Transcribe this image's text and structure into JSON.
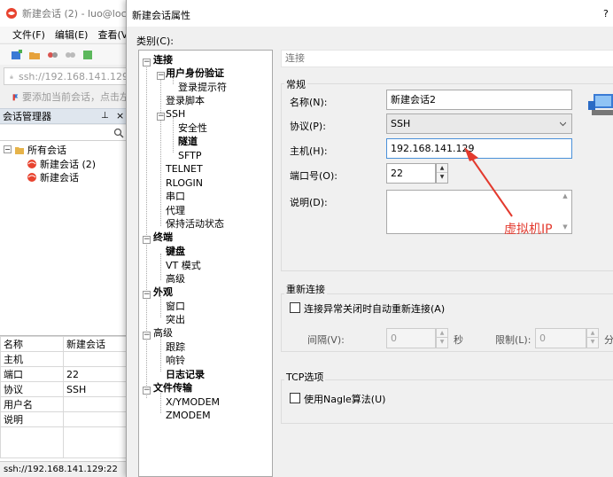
{
  "bg_app": {
    "title": "新建会话 (2) - luo@loca",
    "menu": [
      "文件(F)",
      "编辑(E)",
      "查看(V)"
    ],
    "address": "ssh://192.168.141.129",
    "hint": "要添加当前会话，点击左",
    "session_manager": {
      "title": "会话管理器",
      "pin": "ᵩ",
      "close": "×",
      "tree": {
        "root": "所有会话",
        "items": [
          "新建会话 (2)",
          "新建会话"
        ]
      }
    },
    "properties": [
      {
        "key": "名称",
        "value": "新建会话"
      },
      {
        "key": "主机",
        "value": ""
      },
      {
        "key": "端口",
        "value": "22"
      },
      {
        "key": "协议",
        "value": "SSH"
      },
      {
        "key": "用户名",
        "value": ""
      },
      {
        "key": "说明",
        "value": ""
      }
    ],
    "status": "ssh://192.168.141.129:22"
  },
  "dialog": {
    "title": "新建会话属性",
    "help": "?",
    "category_label": "类别(C):",
    "category_tree": [
      {
        "label": "连接",
        "bold": true
      },
      {
        "label": "用户身份验证",
        "bold": true
      },
      {
        "label": "登录提示符",
        "bold": false
      },
      {
        "label": "登录脚本",
        "bold": false
      },
      {
        "label": "SSH",
        "bold": false
      },
      {
        "label": "安全性",
        "bold": false
      },
      {
        "label": "隧道",
        "bold": true
      },
      {
        "label": "SFTP",
        "bold": false
      },
      {
        "label": "TELNET",
        "bold": false
      },
      {
        "label": "RLOGIN",
        "bold": false
      },
      {
        "label": "串口",
        "bold": false
      },
      {
        "label": "代理",
        "bold": false
      },
      {
        "label": "保持活动状态",
        "bold": false
      },
      {
        "label": "终端",
        "bold": true
      },
      {
        "label": "键盘",
        "bold": true
      },
      {
        "label": "VT 模式",
        "bold": false
      },
      {
        "label": "高级",
        "bold": false
      },
      {
        "label": "外观",
        "bold": true
      },
      {
        "label": "窗口",
        "bold": false
      },
      {
        "label": "突出",
        "bold": false
      },
      {
        "label": "高级",
        "bold": false
      },
      {
        "label": "跟踪",
        "bold": false
      },
      {
        "label": "响铃",
        "bold": false
      },
      {
        "label": "日志记录",
        "bold": true
      },
      {
        "label": "文件传输",
        "bold": true
      },
      {
        "label": "X/YMODEM",
        "bold": false
      },
      {
        "label": "ZMODEM",
        "bold": false
      }
    ],
    "section_header": "连接",
    "general": {
      "title": "常规",
      "name_label": "名称(N):",
      "name_value": "新建会话2",
      "protocol_label": "协议(P):",
      "protocol_value": "SSH",
      "host_label": "主机(H):",
      "host_value": "192.168.141.129",
      "port_label": "端口号(O):",
      "port_value": "22",
      "desc_label": "说明(D):",
      "desc_value": ""
    },
    "reconnect": {
      "title": "重新连接",
      "checkbox_label": "连接异常关闭时自动重新连接(A)",
      "interval_label": "间隔(V):",
      "interval_value": "0",
      "seconds": "秒",
      "limit_label": "限制(L):",
      "limit_value": "0",
      "minutes": "分"
    },
    "tcp": {
      "title": "TCP选项",
      "nagle_label": "使用Nagle算法(U)"
    }
  },
  "annotation": {
    "text": "虚拟机IP",
    "color": "#e33a2e"
  }
}
